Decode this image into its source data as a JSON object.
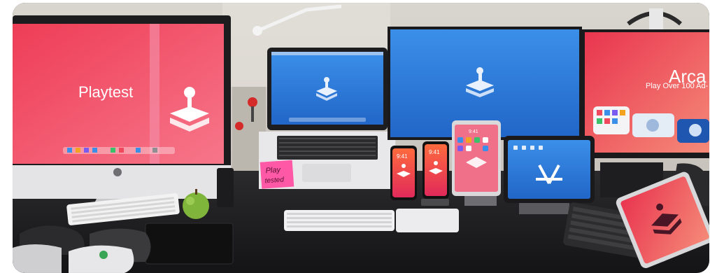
{
  "scene": {
    "description_label": "",
    "imac_screen": {
      "title": "Playtest",
      "color_top": "#f0475a",
      "color_bottom": "#f56a7c"
    },
    "laptop_screen": {
      "color": "#2f7fd8"
    },
    "center_monitor": {
      "color": "#2a86e4"
    },
    "right_monitor": {
      "brand": "Arca",
      "subtitle": "Play Over 100 Ad-",
      "color": "#f0485c"
    },
    "sticky_note": {
      "line1": "Play",
      "line2": "tested"
    },
    "phone1_time": "9:41",
    "phone2_time": "9:41",
    "tablet_small_time": "9:41"
  }
}
